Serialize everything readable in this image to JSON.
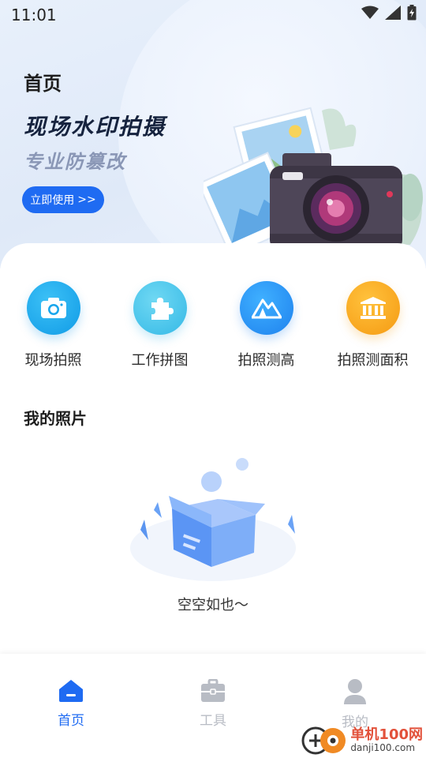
{
  "status_bar": {
    "time": "11:01"
  },
  "hero": {
    "title": "首页",
    "headline": "现场水印拍摄",
    "subheadline": "专业防篡改",
    "cta_label": "立即使用",
    "cta_arrows": ">>"
  },
  "features": [
    {
      "label": "现场拍照",
      "icon": "camera-icon",
      "color": "#1aa6ec"
    },
    {
      "label": "工作拼图",
      "icon": "puzzle-icon",
      "color": "#3ec4e8"
    },
    {
      "label": "拍照测高",
      "icon": "mountain-icon",
      "color": "#2e8ef5"
    },
    {
      "label": "拍照测面积",
      "icon": "building-icon",
      "color": "#f6a21a"
    }
  ],
  "photos": {
    "title": "我的照片",
    "empty_text": "空空如也～"
  },
  "tabs": [
    {
      "label": "首页",
      "icon": "home-icon",
      "active": true
    },
    {
      "label": "工具",
      "icon": "toolbox-icon",
      "active": false
    },
    {
      "label": "我的",
      "icon": "user-icon",
      "active": false
    }
  ],
  "watermark": {
    "line1": "单机100网",
    "line2": "danji100.com"
  },
  "colors": {
    "accent": "#1f6bf2",
    "tab_inactive": "#b8bcc4"
  }
}
